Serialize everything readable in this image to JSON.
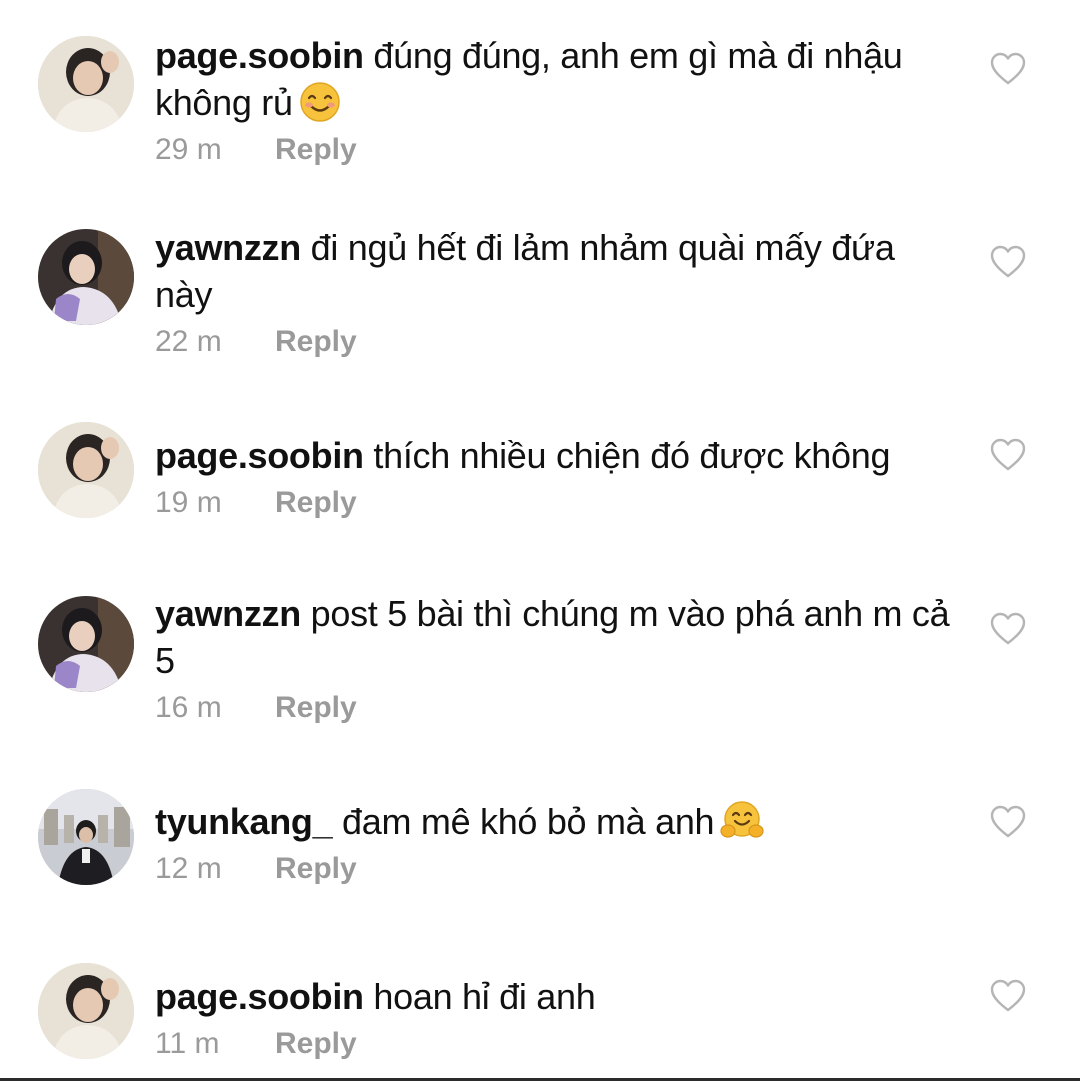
{
  "comments": [
    {
      "username": "page.soobin",
      "text": "đúng đúng, anh em gì mà đi nhậu không rủ",
      "emoji": "smiling-face-icon",
      "time": "29 m",
      "reply": "Reply",
      "avatar": "avatar-soobin"
    },
    {
      "username": "yawnzzn",
      "text": "đi ngủ hết đi lảm nhảm quài mấy đứa này",
      "time": "22 m",
      "reply": "Reply",
      "avatar": "avatar-yawnzzn"
    },
    {
      "username": "page.soobin",
      "text": "thích nhiều chiện đó được không",
      "time": "19 m",
      "reply": "Reply",
      "avatar": "avatar-soobin"
    },
    {
      "username": "yawnzzn",
      "text": "post 5 bài thì chúng m vào phá anh m cả 5",
      "time": "16 m",
      "reply": "Reply",
      "avatar": "avatar-yawnzzn"
    },
    {
      "username": "tyunkang_",
      "text": "đam mê khó bỏ mà anh",
      "emoji": "hugging-face-icon",
      "time": "12 m",
      "reply": "Reply",
      "avatar": "avatar-tyunkang"
    },
    {
      "username": "page.soobin",
      "text": "hoan hỉ đi anh",
      "time": "11 m",
      "reply": "Reply",
      "avatar": "avatar-soobin"
    }
  ],
  "colors": {
    "text": "#111111",
    "muted": "#9a9a9a",
    "heart_outline": "#b5b5b5"
  }
}
